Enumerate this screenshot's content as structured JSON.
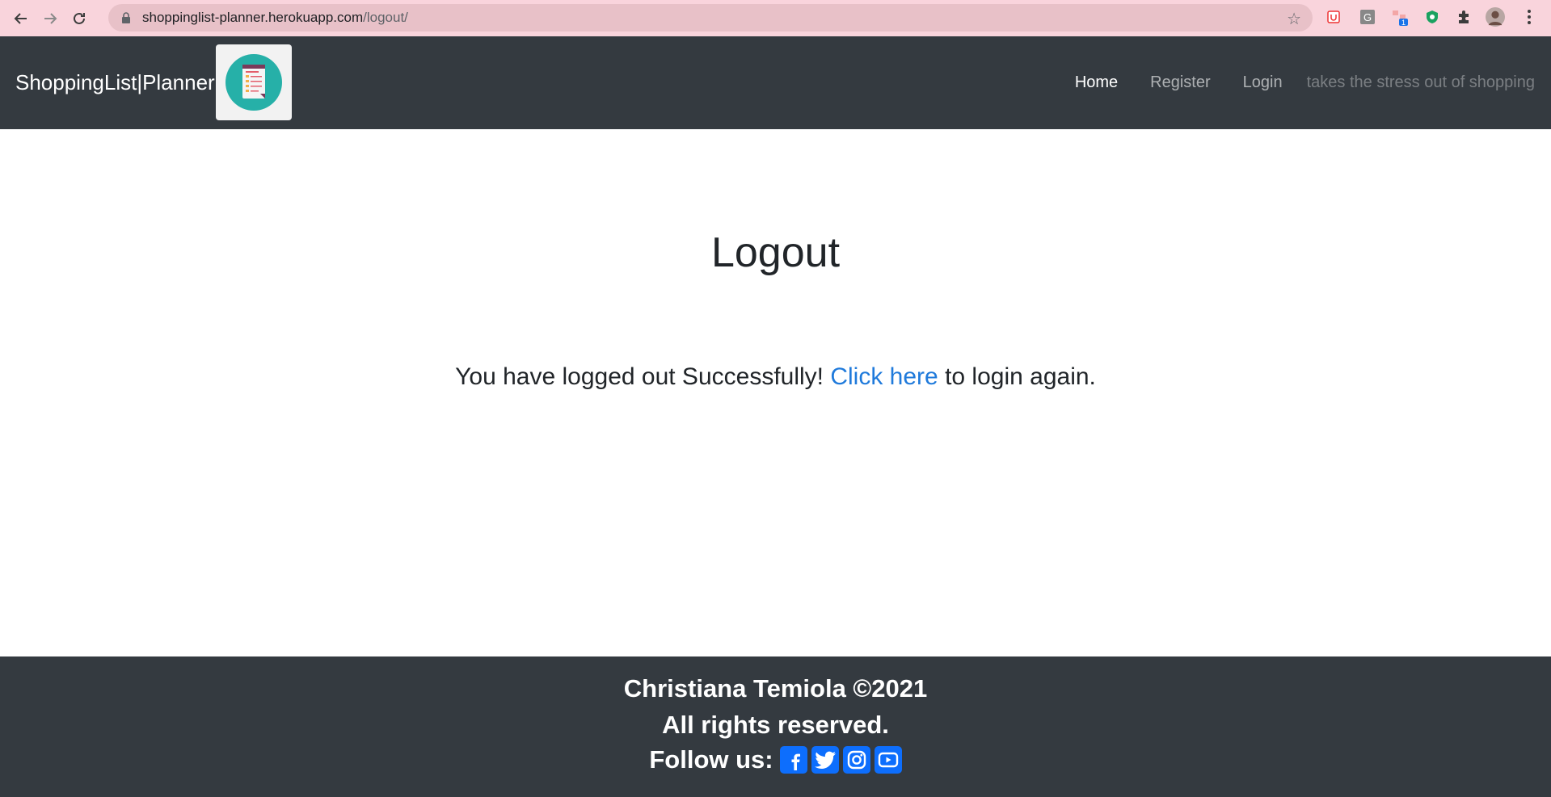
{
  "browser": {
    "url_host": "shoppinglist-planner.herokuapp.com",
    "url_path": "/logout/",
    "icons": [
      "back-arrow-icon",
      "forward-arrow-icon",
      "reload-icon",
      "lock-icon",
      "bookmark-star-icon",
      "extension-icons",
      "puzzle-icon",
      "profile-avatar",
      "menu-kebab-icon"
    ],
    "extension_badge": "1"
  },
  "header": {
    "brand": "ShoppingList|Planner",
    "nav": [
      {
        "label": "Home",
        "active": true
      },
      {
        "label": "Register",
        "active": false
      },
      {
        "label": "Login",
        "active": false
      }
    ],
    "tagline": "takes the stress out of shopping"
  },
  "main": {
    "title": "Logout",
    "message_before": "You have logged out Successfully!",
    "link_text": "Click here",
    "message_after": "to login again."
  },
  "footer": {
    "copyright": "Christiana Temiola ©2021",
    "rights": "All rights reserved.",
    "follow_label": "Follow us:",
    "social": [
      "facebook-icon",
      "twitter-icon",
      "instagram-icon",
      "youtube-icon"
    ]
  },
  "colors": {
    "header_bg": "#343a40",
    "link": "#1f7adb",
    "social": "#0d6efd",
    "chrome_bg": "#f9d4dc"
  }
}
